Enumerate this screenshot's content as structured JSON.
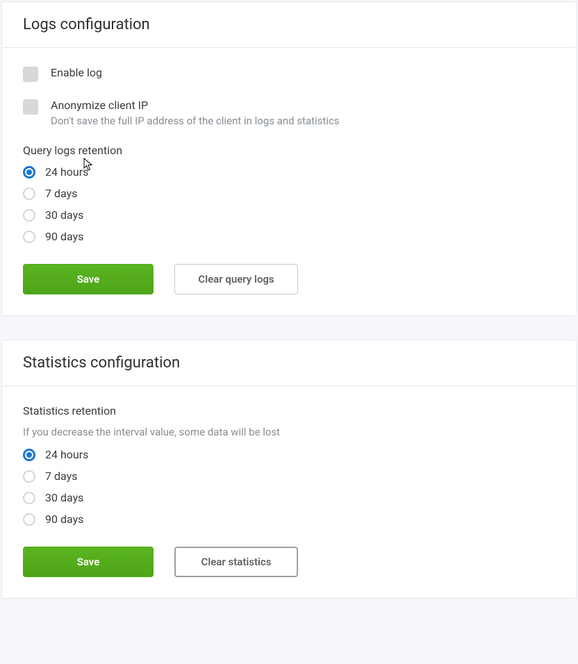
{
  "logs": {
    "title": "Logs configuration",
    "enable_log_label": "Enable log",
    "anonymize_label": "Anonymize client IP",
    "anonymize_desc": "Don't save the full IP address of the client in logs and statistics",
    "retention_label": "Query logs retention",
    "retention_options": [
      {
        "label": "24 hours",
        "selected": true
      },
      {
        "label": "7 days",
        "selected": false
      },
      {
        "label": "30 days",
        "selected": false
      },
      {
        "label": "90 days",
        "selected": false
      }
    ],
    "save_label": "Save",
    "clear_label": "Clear query logs"
  },
  "stats": {
    "title": "Statistics configuration",
    "retention_label": "Statistics retention",
    "retention_desc": "If you decrease the interval value, some data will be lost",
    "retention_options": [
      {
        "label": "24 hours",
        "selected": true
      },
      {
        "label": "7 days",
        "selected": false
      },
      {
        "label": "30 days",
        "selected": false
      },
      {
        "label": "90 days",
        "selected": false
      }
    ],
    "save_label": "Save",
    "clear_label": "Clear statistics"
  }
}
